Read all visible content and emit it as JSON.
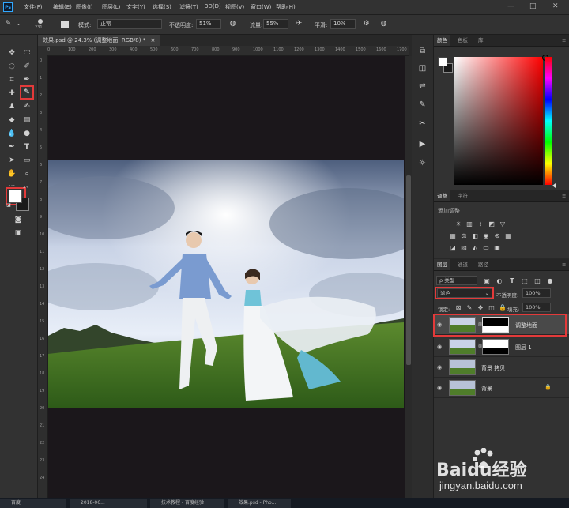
{
  "menu": {
    "logo": "Ps",
    "items": [
      "文件(F)",
      "编辑(E)",
      "图像(I)",
      "图层(L)",
      "文字(Y)",
      "选择(S)",
      "滤镜(T)",
      "3D(D)",
      "视图(V)",
      "窗口(W)",
      "帮助(H)"
    ],
    "window_controls": [
      "—",
      "□",
      "✕"
    ]
  },
  "options": {
    "brush_size": "231",
    "mode_label": "模式:",
    "mode_value": "正常",
    "opacity_label": "不透明度:",
    "opacity_value": "51%",
    "flow_label": "流量:",
    "flow_value": "55%",
    "smooth_label": "平滑:",
    "smooth_value": "10%"
  },
  "document": {
    "tab_title": "效果.psd @ 24.3% (调整地面, RGB/8) *",
    "tab_close": "×",
    "ruler_top": [
      "0",
      "100",
      "200",
      "300",
      "400",
      "500",
      "600",
      "700",
      "800",
      "900",
      "1000",
      "1100",
      "1200",
      "1300",
      "1400",
      "1500",
      "1600",
      "1700"
    ],
    "ruler_left": [
      "0",
      "1",
      "2",
      "3",
      "4",
      "5",
      "6",
      "7",
      "8",
      "9",
      "10",
      "11",
      "12",
      "13",
      "14",
      "15",
      "16",
      "17",
      "18",
      "19",
      "20",
      "21",
      "22",
      "23",
      "24"
    ]
  },
  "panels": {
    "color_tabs": [
      "颜色",
      "色板",
      "库"
    ],
    "adjust_tabs": [
      "调整",
      "字符"
    ],
    "adjust_title": "添加调整",
    "layers_tabs": [
      "图层",
      "通道",
      "路径"
    ],
    "kind_filter": "ρ 类型",
    "blend_mode": "滤色",
    "opacity_label": "不透明度:",
    "opacity_value": "100%",
    "lock_label": "锁定:",
    "fill_label": "填充:",
    "fill_value": "100%"
  },
  "layers": [
    {
      "name": "调整地面",
      "selected": true
    },
    {
      "name": "图层 1",
      "selected": false
    },
    {
      "name": "背景 拷贝",
      "selected": false
    },
    {
      "name": "背景",
      "selected": false
    }
  ],
  "taskbar": {
    "items": [
      "百度",
      "2018-06...",
      "技术教程 - 百度经验",
      "效果.psd - Pho..."
    ]
  },
  "watermark": {
    "brand_text": "Baidu经验",
    "url": "jingyan.baidu.com"
  },
  "colors": {
    "foreground": "#ffffff",
    "background": "#1a1a1a",
    "highlight_red": "#e33a3a"
  }
}
